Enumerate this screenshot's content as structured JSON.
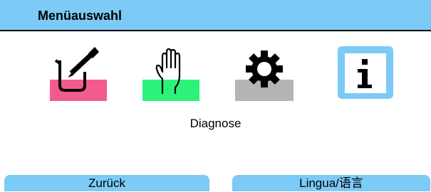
{
  "header": {
    "title": "Menüauswahl"
  },
  "menu": {
    "items": [
      {
        "id": "measure",
        "icon": "beaker-pen-icon",
        "color": "#f35b8d"
      },
      {
        "id": "calibrate",
        "icon": "hand-icon",
        "color": "#2df27a"
      },
      {
        "id": "config",
        "icon": "gear-icon",
        "color": "#b4b4b4"
      },
      {
        "id": "info",
        "icon": "info-icon",
        "color": "#7ccaf6",
        "selected": true
      }
    ],
    "selected_label": "Diagnose"
  },
  "softkeys": {
    "left": "Zurück",
    "right": "Lingua/语言"
  },
  "colors": {
    "accent": "#7ccaf6",
    "background": "#ffffff"
  }
}
